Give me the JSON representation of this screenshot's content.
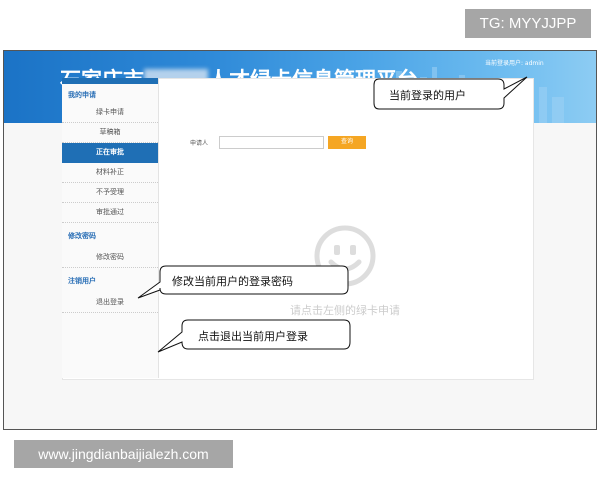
{
  "watermark_top": "TG: MYYJJPP",
  "watermark_bottom": "www.jingdianbaijialezh.com",
  "header": {
    "title_left": "石家庄市",
    "title_right": "人才绿卡信息管理平台",
    "user_status": "当前登录用户: admin"
  },
  "sidebar": {
    "group_apply": "我的申请",
    "items_apply": [
      "绿卡申请",
      "草稿箱",
      "正在审批",
      "材料补正",
      "不予受理",
      "审批通过"
    ],
    "active_item": "正在审批",
    "group_password": "修改密码",
    "item_password": "修改密码",
    "group_logout": "注销用户",
    "item_logout": "退出登录"
  },
  "search": {
    "label": "申请人",
    "value": "",
    "button": "查询"
  },
  "empty_state": {
    "message": "请点击左侧的绿卡申请",
    "icon": "smiley-icon"
  },
  "callouts": {
    "current_user": "当前登录的用户",
    "change_password": "修改当前用户的登录密码",
    "logout": "点击退出当前用户登录"
  },
  "colors": {
    "banner": "#2f8ad8",
    "sidebar_active": "#1f6fb5",
    "search_button": "#f5a623",
    "sidebar_group": "#2a6fb6"
  }
}
